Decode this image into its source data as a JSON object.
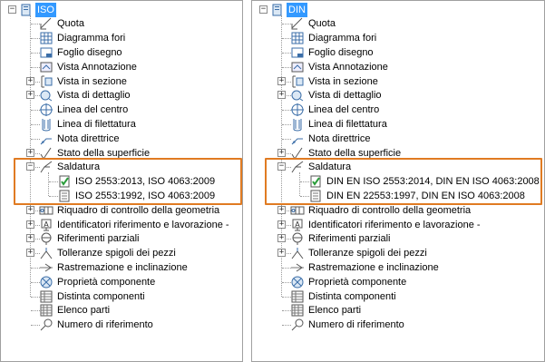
{
  "left": {
    "root": "ISO",
    "items": [
      "Quota",
      "Diagramma fori",
      "Foglio disegno",
      "Vista Annotazione",
      "Vista in sezione",
      "Vista di dettaglio",
      "Linea del centro",
      "Linea di filettatura",
      "Nota direttrice",
      "Stato della superficie",
      "Saldatura",
      "Riquadro di controllo della geometria",
      "Identificatori riferimento e lavorazione -",
      "Riferimenti parziali",
      "Tolleranze spigoli dei pezzi",
      "Rastremazione e inclinazione",
      "Proprietà componente",
      "Distinta componenti",
      "Elenco parti",
      "Numero di riferimento"
    ],
    "children": [
      "ISO 2553:2013, ISO 4063:2009",
      "ISO 2553:1992, ISO 4063:2009"
    ]
  },
  "right": {
    "root": "DIN",
    "items": [
      "Quota",
      "Diagramma fori",
      "Foglio disegno",
      "Vista Annotazione",
      "Vista in sezione",
      "Vista di dettaglio",
      "Linea del centro",
      "Linea di filettatura",
      "Nota direttrice",
      "Stato della superficie",
      "Saldatura",
      "Riquadro di controllo della geometria",
      "Identificatori riferimento e lavorazione -",
      "Riferimenti parziali",
      "Tolleranze spigoli dei pezzi",
      "Rastremazione e inclinazione",
      "Proprietà componente",
      "Distinta componenti",
      "Elenco parti",
      "Numero di riferimento"
    ],
    "children": [
      "DIN EN ISO 2553:2014, DIN EN ISO 4063:2008",
      "DIN EN 22553:1997, DIN EN ISO 4063:2008"
    ]
  },
  "colors": {
    "selection": "#3399ff",
    "highlight": "#e07b22"
  }
}
